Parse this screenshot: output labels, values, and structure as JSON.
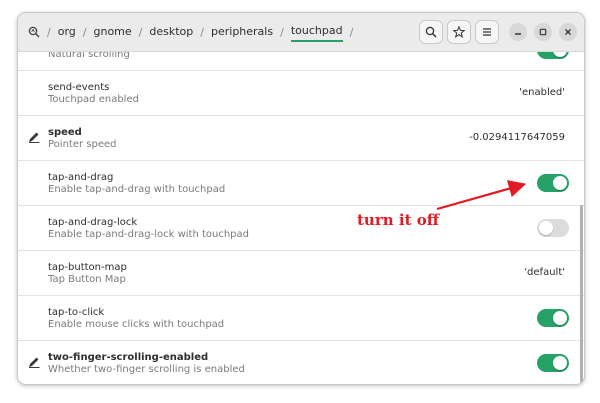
{
  "path": {
    "root_icon": "dconf-editor-icon",
    "segments": [
      "org",
      "gnome",
      "desktop",
      "peripherals",
      "touchpad"
    ],
    "separator": "/"
  },
  "header_buttons": {
    "search_icon": "search-icon",
    "bookmark_icon": "star-icon",
    "menu_icon": "hamburger-menu-icon"
  },
  "window_buttons": {
    "minimize_icon": "minimize-icon",
    "maximize_icon": "maximize-icon",
    "close_icon": "close-icon"
  },
  "rows": {
    "natural_scrolling": {
      "desc": "Natural scrolling",
      "toggle": true
    },
    "send_events": {
      "name": "send-events",
      "desc": "Touchpad enabled",
      "value": "'enabled'"
    },
    "speed": {
      "name": "speed",
      "desc": "Pointer speed",
      "value": "-0.0294117647059",
      "modified": true
    },
    "tap_and_drag": {
      "name": "tap-and-drag",
      "desc": "Enable tap-and-drag with touchpad",
      "toggle": true
    },
    "tap_and_drag_lock": {
      "name": "tap-and-drag-lock",
      "desc": "Enable tap-and-drag-lock with touchpad",
      "toggle": false
    },
    "tap_button_map": {
      "name": "tap-button-map",
      "desc": "Tap Button Map",
      "value": "'default'"
    },
    "tap_to_click": {
      "name": "tap-to-click",
      "desc": "Enable mouse clicks with touchpad",
      "toggle": true
    },
    "two_finger_scrolling": {
      "name": "two-finger-scrolling-enabled",
      "desc": "Whether two-finger scrolling is enabled",
      "toggle": true,
      "modified": true
    }
  },
  "annotation": {
    "text": "turn it off",
    "color": "#e01b24"
  },
  "colors": {
    "accent": "#26a269",
    "toggle_off": "#dcdcdc",
    "annotation": "#e01b24"
  }
}
